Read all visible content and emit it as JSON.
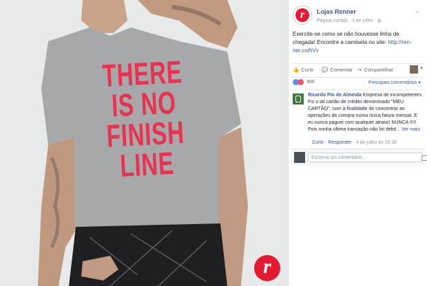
{
  "photo": {
    "shirt_lines": [
      "THERE",
      "IS NO",
      "FINISH",
      "LINE"
    ],
    "brand_mark": "r"
  },
  "post": {
    "logo_letter": "r",
    "page_name": "Lojas Renner",
    "meta": "Página curtida · 1 de julho · ",
    "text_before_link": "Exercite-se como se não houvesse linha de chegada! Encontre a camiseta no site: ",
    "link": "http://ren-ner.co/hVv"
  },
  "actions": {
    "like": "Curtir",
    "comment": "Comentar",
    "share": "Compartilhar"
  },
  "reactions": {
    "count": "460",
    "sort_label": "Principais comentários ▾"
  },
  "comment": {
    "author": "Ricardo Pio de Almeida",
    "text": " Empresa de incompetentes. Fiz o tal cartão de crédito denominado \"MEU CARTÃO\", com a finalidade de concentrar as operações de compra numa única fatura mensal. E eu nunca paguei com qualquer atraso! NUNCA !!!!! Pois minha última transação não foi debit",
    "more": "... Ver mais",
    "like": "Curtir",
    "reply": "Responder",
    "timestamp": " · 4 de julho às 18:38"
  },
  "composer": {
    "placeholder": "Escreva um comentário..."
  },
  "colors": {
    "brand_red": "#e41b30",
    "shirt_print": "#e8324f",
    "link_blue": "#365899"
  }
}
